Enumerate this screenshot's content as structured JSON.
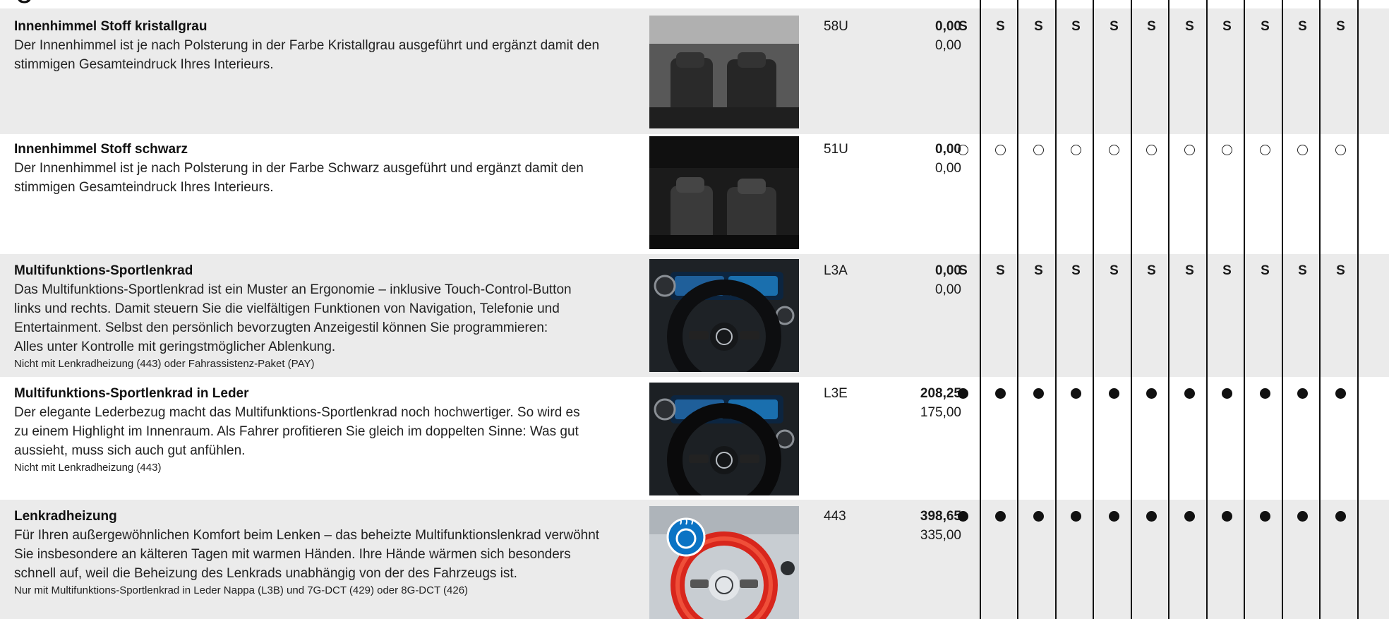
{
  "options": [
    {
      "title": "Innenhimmel Stoff kristallgrau",
      "lines": [
        "Der Innenhimmel ist je nach Polsterung in der Farbe Kristallgrau ausgeführt und ergänzt damit den",
        "stimmigen Gesamteindruck Ihres Interieurs."
      ],
      "note": "",
      "image": "interior-ceiling-grey-photo",
      "code": "58U",
      "price_gross": "0,00",
      "price_net": "0,00",
      "availability": [
        "S",
        "S",
        "S",
        "S",
        "S",
        "S",
        "S",
        "S",
        "S",
        "S",
        "S"
      ]
    },
    {
      "title": "Innenhimmel Stoff schwarz",
      "lines": [
        "Der Innenhimmel ist je nach Polsterung in der Farbe Schwarz ausgeführt und ergänzt damit den",
        "stimmigen Gesamteindruck Ihres Interieurs."
      ],
      "note": "",
      "image": "interior-ceiling-black-photo",
      "code": "51U",
      "price_gross": "0,00",
      "price_net": "0,00",
      "availability": [
        "○",
        "○",
        "○",
        "○",
        "○",
        "○",
        "○",
        "○",
        "○",
        "○",
        "○"
      ]
    },
    {
      "title": "Multifunktions-Sportlenkrad",
      "lines": [
        "Das Multifunktions-Sportlenkrad ist ein Muster an Ergonomie – inklusive Touch-Control-Button",
        "links und rechts. Damit steuern Sie die vielfältigen Funktionen von Navigation, Telefonie und",
        "Entertainment. Selbst den persönlich bevorzugten Anzeigestil können Sie programmieren:",
        "Alles unter Kontrolle mit geringstmöglicher Ablenkung."
      ],
      "note": "Nicht mit Lenkradheizung (443) oder Fahrassistenz-Paket (PAY)",
      "image": "steering-wheel-photo",
      "code": "L3A",
      "price_gross": "0,00",
      "price_net": "0,00",
      "availability": [
        "S",
        "S",
        "S",
        "S",
        "S",
        "S",
        "S",
        "S",
        "S",
        "S",
        "S"
      ]
    },
    {
      "title": "Multifunktions-Sportlenkrad in Leder",
      "lines": [
        "Der elegante Lederbezug macht das Multifunktions-Sportlenkrad noch hochwertiger. So wird es",
        "zu einem Highlight im Innenraum. Als Fahrer profitieren Sie gleich im doppelten Sinne: Was gut",
        "aussieht, muss sich auch gut anfühlen."
      ],
      "note": "Nicht mit Lenkradheizung (443)",
      "image": "leather-steering-wheel-photo",
      "code": "L3E",
      "price_gross": "208,25",
      "price_net": "175,00",
      "availability": [
        "●",
        "●",
        "●",
        "●",
        "●",
        "●",
        "●",
        "●",
        "●",
        "●",
        "●"
      ]
    },
    {
      "title": "Lenkradheizung",
      "lines": [
        "Für Ihren außergewöhnlichen Komfort beim Lenken – das beheizte Multifunktionslenkrad verwöhnt",
        "Sie insbesondere an kälteren Tagen mit warmen Händen. Ihre Hände wärmen sich besonders",
        "schnell auf, weil die Beheizung des Lenkrads unabhängig von der des Fahrzeugs ist."
      ],
      "note": "Nur mit Multifunktions-Sportlenkrad in Leder Nappa (L3B) und 7G-DCT (429) oder 8G-DCT (426)",
      "image": "heated-steering-wheel-photo",
      "code": "443",
      "price_gross": "398,65",
      "price_net": "335,00",
      "availability": [
        "●",
        "●",
        "●",
        "●",
        "●",
        "●",
        "●",
        "●",
        "●",
        "●",
        "●"
      ]
    }
  ],
  "colors": {
    "shade": "#ebebeb",
    "heat_ring": "#d8261c",
    "badge": "#0a73c4"
  }
}
